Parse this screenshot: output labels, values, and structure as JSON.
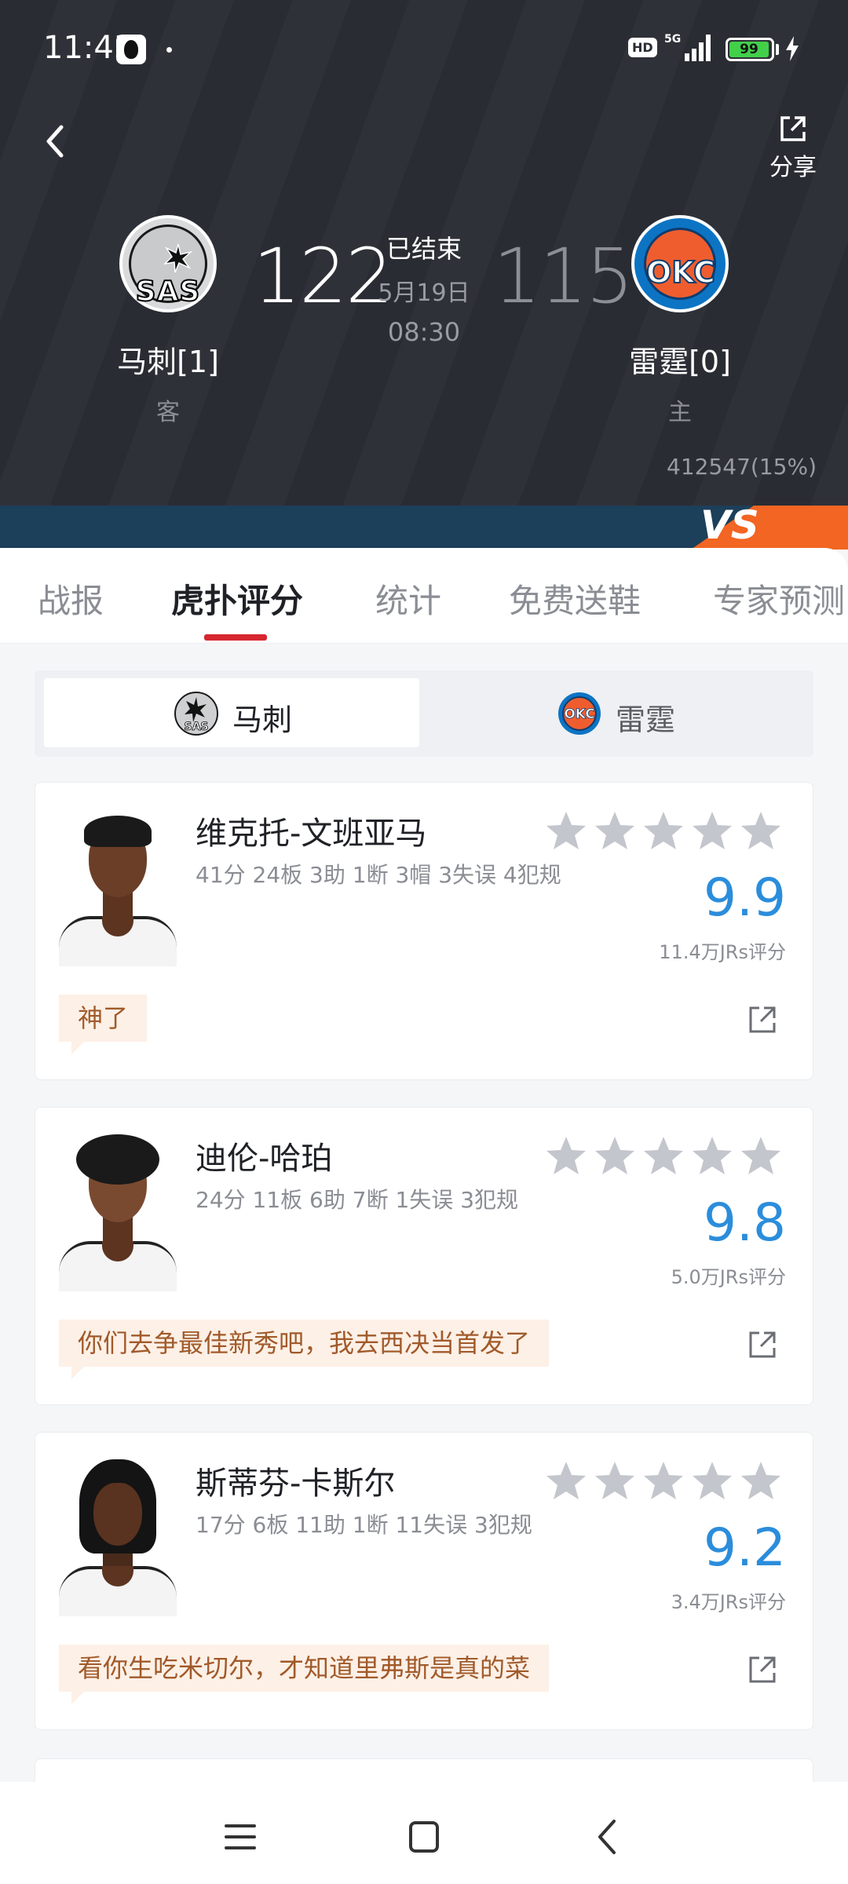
{
  "status_bar": {
    "time": "11:43",
    "network": "5G",
    "battery": "99"
  },
  "header": {
    "share_label": "分享",
    "away_team": {
      "name": "马刺[1]",
      "role": "客",
      "score": "122",
      "logo_text": "SAS"
    },
    "home_team": {
      "name": "雷霆[0]",
      "role": "主",
      "score": "115",
      "logo_text": "OKC"
    },
    "game_status": "已结束",
    "game_date": "5月19日",
    "game_time": "08:30",
    "support_stat": "412547(15%)",
    "vs_text": "VS"
  },
  "tabs": [
    {
      "label": "战报"
    },
    {
      "label": "虎扑评分"
    },
    {
      "label": "统计"
    },
    {
      "label": "免费送鞋"
    },
    {
      "label": "专家预测"
    }
  ],
  "team_switch": {
    "active": {
      "label": "马刺",
      "logo_text": "SAS"
    },
    "inactive": {
      "label": "雷霆",
      "logo_text": "OKC"
    }
  },
  "players": [
    {
      "name": "维克托-文班亚马",
      "stats": "41分 24板 3助 1断 3帽 3失误 4犯规",
      "rating": "9.9",
      "rating_count": "11.4万JRs评分",
      "comment": "神了"
    },
    {
      "name": "迪伦-哈珀",
      "stats": "24分 11板 6助 7断 1失误 3犯规",
      "rating": "9.8",
      "rating_count": "5.0万JRs评分",
      "comment": "你们去争最佳新秀吧，我去西决当首发了"
    },
    {
      "name": "斯蒂芬-卡斯尔",
      "stats": "17分 6板 11助 1断 11失误 3犯规",
      "rating": "9.2",
      "rating_count": "3.4万JRs评分",
      "comment": "看你生吃米切尔，才知道里弗斯是真的菜"
    }
  ],
  "colors": {
    "header_bg": "#2a2c33",
    "accent_red": "#d6262f",
    "rating_blue": "#2b8ddb",
    "comment_bg": "#fdf0e6",
    "comment_text": "#a15a2a"
  }
}
